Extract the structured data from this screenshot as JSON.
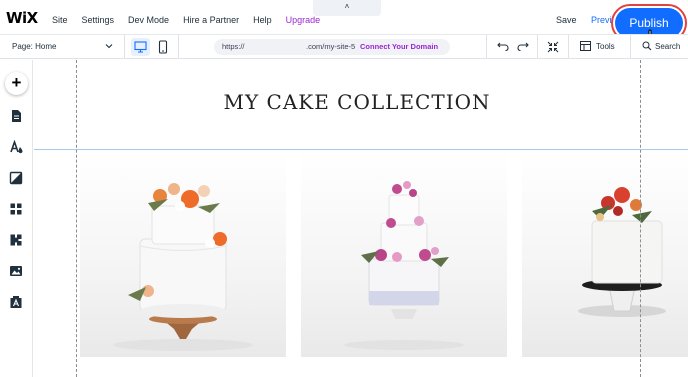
{
  "topbar": {
    "logo": "WiX",
    "menu": [
      "Site",
      "Settings",
      "Dev Mode",
      "Hire a Partner",
      "Help",
      "Upgrade"
    ],
    "collapse_glyph": "˄",
    "save_label": "Save",
    "preview_label": "Preview",
    "publish_label": "Publish"
  },
  "toolbar": {
    "page_label": "Page: Home",
    "url_prefix": "https://",
    "url_suffix": ".com/my-site-5",
    "connect_domain": "Connect Your Domain",
    "tools_label": "Tools",
    "search_label": "Search"
  },
  "sidebar": {
    "add_glyph": "+",
    "icons": [
      "pages-icon",
      "design-icon",
      "background-icon",
      "apps-icon",
      "app-market-icon",
      "media-icon",
      "blog-icon"
    ]
  },
  "canvas": {
    "site_title": "MY CAKE COLLECTION",
    "cards": [
      "cake-photo-orange-flowers",
      "cake-photo-pink-flowers",
      "cake-photo-red-flowers"
    ]
  },
  "colors": {
    "accent": "#116dff",
    "upgrade": "#9a27d5",
    "highlight_ring": "#e0423f"
  }
}
